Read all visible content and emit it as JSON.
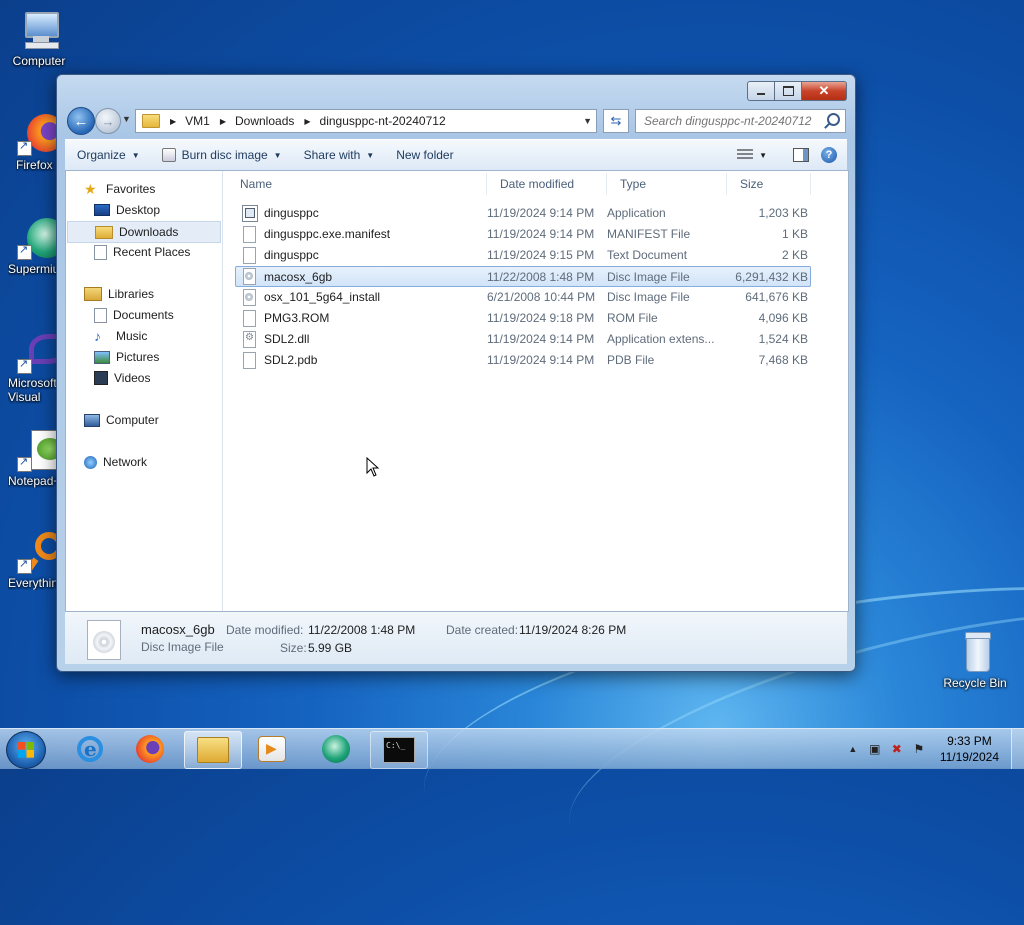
{
  "desktop": {
    "icons": [
      {
        "label": "Computer"
      },
      {
        "label": "Firefox"
      },
      {
        "label": "Supermium"
      },
      {
        "label": "Microsoft Visual Studio"
      },
      {
        "label": "Notepad++"
      },
      {
        "label": "Everything"
      },
      {
        "label": "Recycle Bin"
      }
    ]
  },
  "window": {
    "address": {
      "crumbs": [
        "VM1",
        "Downloads",
        "dingusppc-nt-20240712"
      ]
    },
    "search": {
      "placeholder": "Search dingusppc-nt-20240712"
    },
    "toolbar": {
      "organize": "Organize",
      "burn": "Burn disc image",
      "share": "Share with",
      "new_folder": "New folder"
    },
    "nav": {
      "favorites": "Favorites",
      "desktop": "Desktop",
      "downloads": "Downloads",
      "recent": "Recent Places",
      "libraries": "Libraries",
      "documents": "Documents",
      "music": "Music",
      "pictures": "Pictures",
      "videos": "Videos",
      "computer": "Computer",
      "network": "Network"
    },
    "columns": {
      "name": "Name",
      "date": "Date modified",
      "type": "Type",
      "size": "Size"
    },
    "files": [
      {
        "name": "dingusppc",
        "date": "11/19/2024 9:14 PM",
        "type": "Application",
        "size": "1,203 KB",
        "icon": "app-icon"
      },
      {
        "name": "dingusppc.exe.manifest",
        "date": "11/19/2024 9:14 PM",
        "type": "MANIFEST File",
        "size": "1 KB",
        "icon": "file-icon"
      },
      {
        "name": "dingusppc",
        "date": "11/19/2024 9:15 PM",
        "type": "Text Document",
        "size": "2 KB",
        "icon": "text-file-icon"
      },
      {
        "name": "macosx_6gb",
        "date": "11/22/2008 1:48 PM",
        "type": "Disc Image File",
        "size": "6,291,432 KB",
        "icon": "disc-image-icon",
        "selected": true
      },
      {
        "name": "osx_101_5g64_install",
        "date": "6/21/2008 10:44 PM",
        "type": "Disc Image File",
        "size": "641,676 KB",
        "icon": "disc-image-icon"
      },
      {
        "name": "PMG3.ROM",
        "date": "11/19/2024 9:18 PM",
        "type": "ROM File",
        "size": "4,096 KB",
        "icon": "file-icon"
      },
      {
        "name": "SDL2.dll",
        "date": "11/19/2024 9:14 PM",
        "type": "Application extens...",
        "size": "1,524 KB",
        "icon": "dll-icon"
      },
      {
        "name": "SDL2.pdb",
        "date": "11/19/2024 9:14 PM",
        "type": "PDB File",
        "size": "7,468 KB",
        "icon": "file-icon"
      }
    ],
    "details": {
      "name": "macosx_6gb",
      "type": "Disc Image File",
      "modified_label": "Date modified:",
      "modified_value": "11/22/2008 1:48 PM",
      "created_label": "Date created:",
      "created_value": "11/19/2024 8:26 PM",
      "size_label": "Size:",
      "size_value": "5.99 GB"
    }
  },
  "taskbar": {
    "clock_time": "9:33 PM",
    "clock_date": "11/19/2024"
  }
}
